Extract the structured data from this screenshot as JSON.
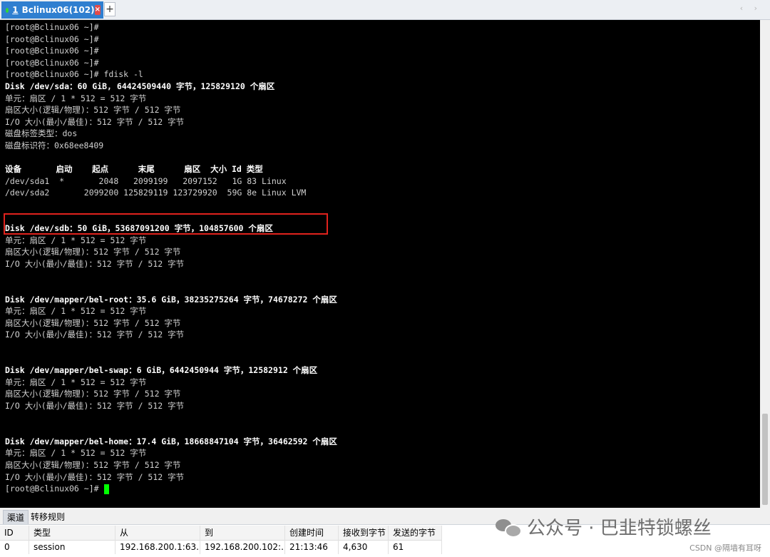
{
  "tab": {
    "number": "1",
    "title": "Bclinux06(102)",
    "close_glyph": "×",
    "add_glyph": "+",
    "nav_glyph": "‹ ›"
  },
  "terminal": {
    "lines": [
      "[root@Bclinux06 ~]#",
      "[root@Bclinux06 ~]#",
      "[root@Bclinux06 ~]#",
      "[root@Bclinux06 ~]#",
      "[root@Bclinux06 ~]# fdisk -l",
      "Disk /dev/sda：60 GiB, 64424509440 字节，125829120 个扇区",
      "单元：扇区 / 1 * 512 = 512 字节",
      "扇区大小(逻辑/物理)：512 字节 / 512 字节",
      "I/O 大小(最小/最佳)：512 字节 / 512 字节",
      "磁盘标签类型：dos",
      "磁盘标识符：0x68ee8409",
      "",
      "设备       启动    起点      末尾      扇区  大小 Id 类型",
      "/dev/sda1  *       2048   2099199   2097152   1G 83 Linux",
      "/dev/sda2       2099200 125829119 123729920  59G 8e Linux LVM",
      "",
      "",
      "Disk /dev/sdb：50 GiB，53687091200 字节，104857600 个扇区",
      "单元：扇区 / 1 * 512 = 512 字节",
      "扇区大小(逻辑/物理)：512 字节 / 512 字节",
      "I/O 大小(最小/最佳)：512 字节 / 512 字节",
      "",
      "",
      "Disk /dev/mapper/bel-root：35.6 GiB，38235275264 字节，74678272 个扇区",
      "单元：扇区 / 1 * 512 = 512 字节",
      "扇区大小(逻辑/物理)：512 字节 / 512 字节",
      "I/O 大小(最小/最佳)：512 字节 / 512 字节",
      "",
      "",
      "Disk /dev/mapper/bel-swap：6 GiB，6442450944 字节，12582912 个扇区",
      "单元：扇区 / 1 * 512 = 512 字节",
      "扇区大小(逻辑/物理)：512 字节 / 512 字节",
      "I/O 大小(最小/最佳)：512 字节 / 512 字节",
      "",
      "",
      "Disk /dev/mapper/bel-home：17.4 GiB，18668847104 字节，36462592 个扇区",
      "单元：扇区 / 1 * 512 = 512 字节",
      "扇区大小(逻辑/物理)：512 字节 / 512 字节",
      "I/O 大小(最小/最佳)：512 字节 / 512 字节",
      "[root@Bclinux06 ~]#"
    ],
    "bold_lines": [
      5,
      12,
      17,
      23,
      29,
      35
    ]
  },
  "panel": {
    "tabs": [
      "渠道",
      "转移规则"
    ],
    "columns": [
      "ID",
      "类型",
      "从",
      "到",
      "创建时间",
      "接收到字节",
      "发送的字节"
    ],
    "rows": [
      [
        "0",
        "session",
        "192.168.200.1:63...",
        "192.168.200.102:...",
        "21:13:46",
        "4,630",
        "61"
      ]
    ]
  },
  "watermark": {
    "text": "公众号 · 巴韭特锁螺丝",
    "icon": "wechat-icon"
  },
  "credit": "CSDN @隔墙有耳呀",
  "colors": {
    "tab_active": "#2f7fd0",
    "terminal_bg": "#000000",
    "cursor": "#00ff00",
    "highlight": "#e0221d"
  }
}
